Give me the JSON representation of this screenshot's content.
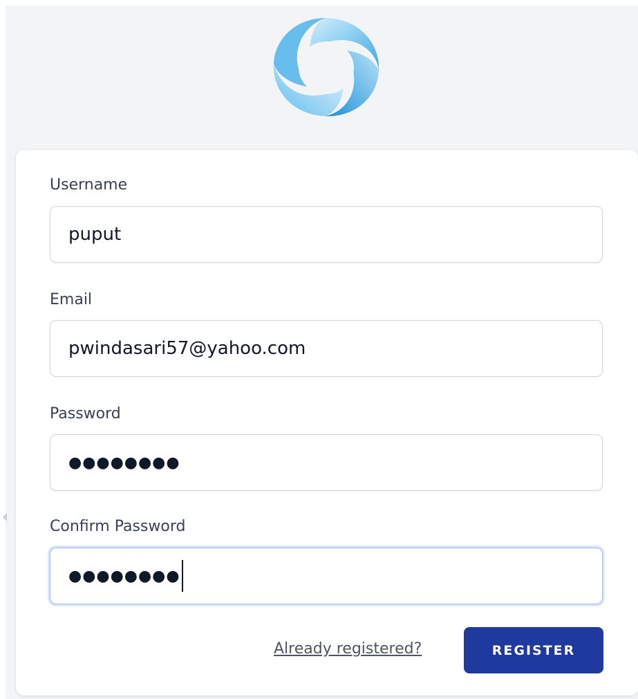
{
  "logo": {
    "icon": "swirl-logo-icon",
    "colors": [
      "#9fd8f5",
      "#3aa9e6",
      "#1b8fd6"
    ]
  },
  "form": {
    "username": {
      "label": "Username",
      "value": "puput"
    },
    "email": {
      "label": "Email",
      "value": "pwindasari57@yahoo.com"
    },
    "password": {
      "label": "Password",
      "value": "●●●●●●●●"
    },
    "confirm_password": {
      "label": "Confirm Password",
      "value": "●●●●●●●●"
    }
  },
  "actions": {
    "already_registered": "Already registered?",
    "register": "REGISTER"
  },
  "colors": {
    "accent": "#1e3a9e",
    "focus": "#a5b4fc",
    "background": "#f3f4f6"
  }
}
